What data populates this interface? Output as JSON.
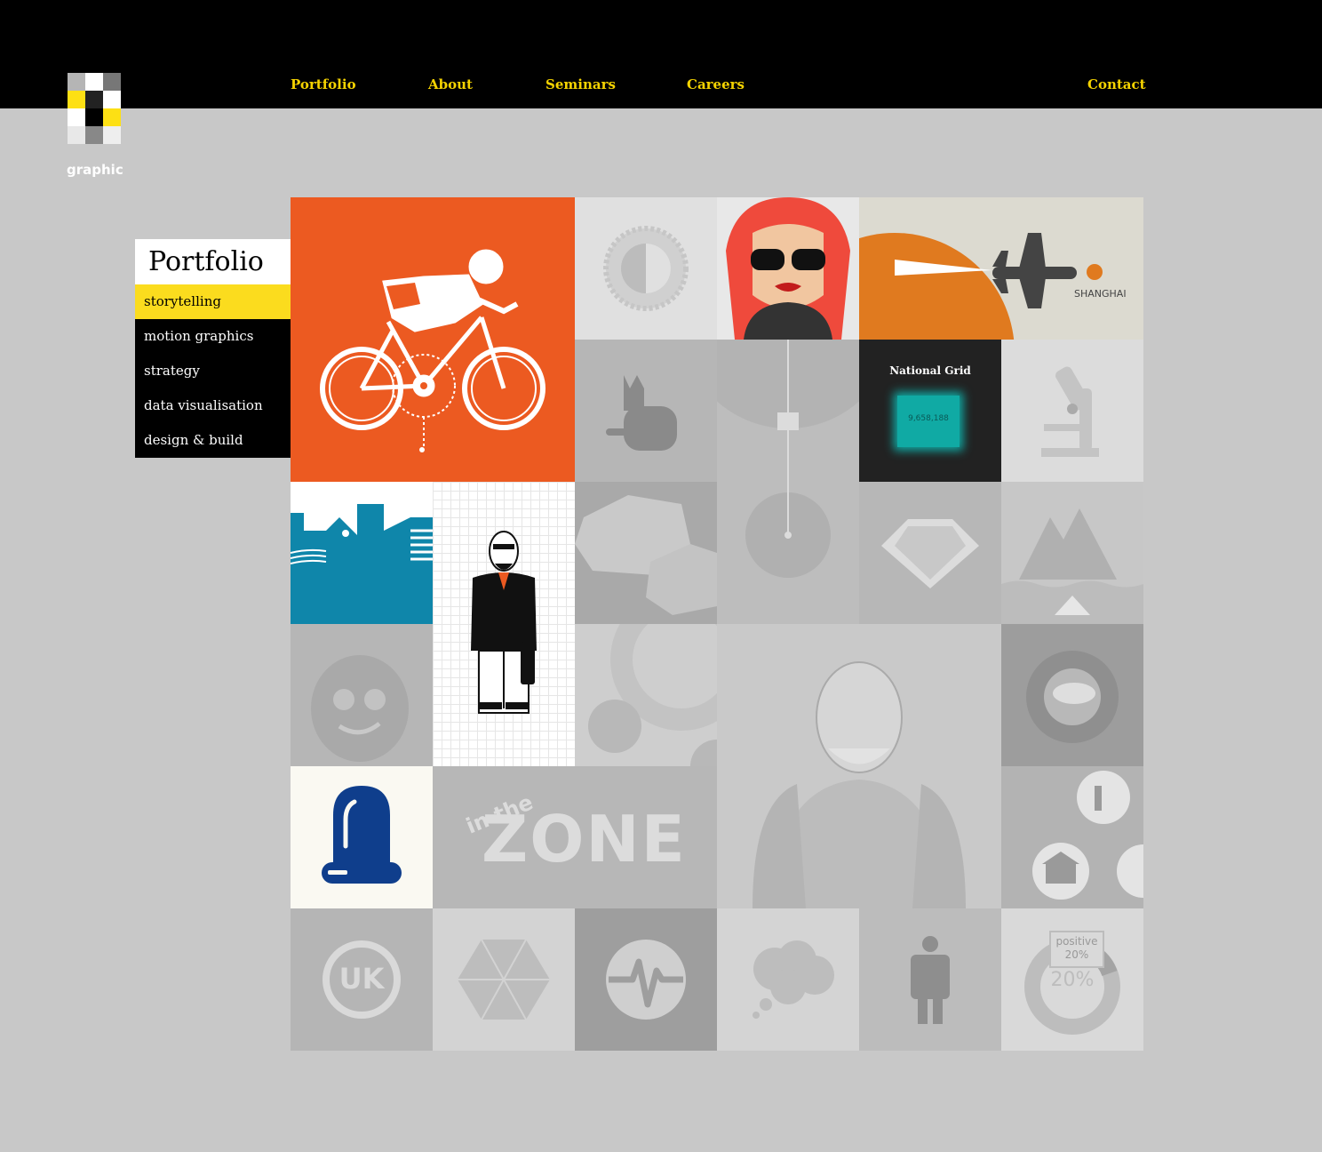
{
  "nav": {
    "portfolio": "Portfolio",
    "about": "About",
    "seminars": "Seminars",
    "careers": "Careers",
    "contact": "Contact"
  },
  "logo": {
    "text": "graphic"
  },
  "sidebar": {
    "title": "Portfolio",
    "items": [
      {
        "label": "storytelling"
      },
      {
        "label": "motion graphics"
      },
      {
        "label": "strategy"
      },
      {
        "label": "data visualisation"
      },
      {
        "label": "design & build"
      }
    ]
  },
  "tiles": {
    "shanghai_label": "SHANGHAI",
    "national_grid_title": "National Grid",
    "national_grid_value": "9,658,188",
    "zone_line1": "in the",
    "zone_line2": "ZONE",
    "positive_label": "positive",
    "positive_pct": "20%",
    "donut_pct": "20%",
    "uk_label": "UK"
  },
  "colors": {
    "nav_text": "#f5d300",
    "active_menu": "#fbdc1e",
    "orange": "#ec5a21",
    "blue_tile": "#0f86aa",
    "navy_icon": "#0f3e8c",
    "teal": "#10aaa4"
  }
}
